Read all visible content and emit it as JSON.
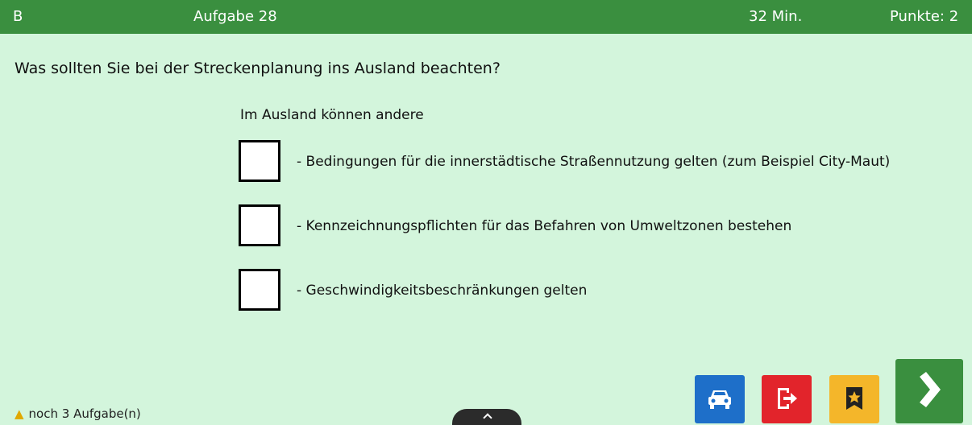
{
  "header": {
    "class_label": "B",
    "task_label": "Aufgabe 28",
    "time_label": "32 Min.",
    "points_label": "Punkte: 2"
  },
  "question": "Was sollten Sie bei der Streckenplanung ins Ausland beachten?",
  "intro": "Im Ausland können andere",
  "options": [
    {
      "text": "- Bedingungen für die innerstädtische Straßennutzung gelten (zum Beispiel City-Maut)",
      "checked": false
    },
    {
      "text": "- Kennzeichnungspflichten für das Befahren von Umweltzonen bestehen",
      "checked": false
    },
    {
      "text": "- Geschwindigkeitsbeschränkungen gelten",
      "checked": false
    }
  ],
  "footer": {
    "remaining": "noch 3 Aufgabe(n)"
  },
  "icons": {
    "car": "car-icon",
    "exit": "exit-icon",
    "favorite": "star-bookmark-icon",
    "next": "chevron-right-icon",
    "warning": "warning-icon"
  },
  "colors": {
    "header": "#3a8f3f",
    "background": "#d3f5dc",
    "car_button": "#1e6fc9",
    "exit_button": "#e2242b",
    "favorite_button": "#f4b62a",
    "next_button": "#3a8f3f"
  }
}
